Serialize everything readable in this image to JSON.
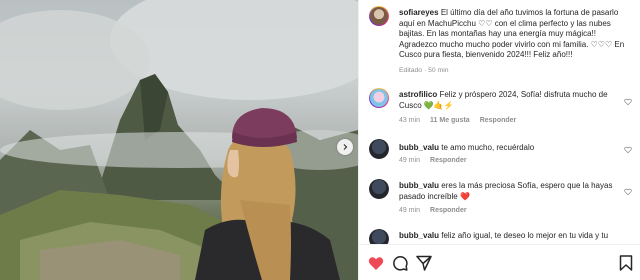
{
  "caption": {
    "username": "sofiareyes",
    "text": "El último día del año tuvimos la fortuna de pasarlo aquí en MachuPicchu ♡♡ con el clima perfecto y las nubes bajitas. En las montañas hay una energía muy mágica!! Agradezco mucho mucho poder vivirlo con mi familia. ♡♡♡ En Cusco pura fiesta, bienvenido 2024!!! Feliz año!!!",
    "edited": "Editado · 50 min"
  },
  "comments": [
    {
      "username": "astrofilico",
      "text": "Feliz y próspero 2024, Sofía! disfruta mucho de Cusco",
      "emoji": "💚🤙⚡",
      "time": "43 min",
      "likes": "11 Me gusta",
      "reply": "Responder"
    },
    {
      "username": "bubb_valu",
      "text": "te amo mucho, recuérdalo",
      "time": "49 min",
      "reply": "Responder"
    },
    {
      "username": "bubb_valu",
      "text": "eres la más preciosa Sofía, espero que la hayas pasado increíble",
      "emoji": "❤️",
      "time": "49 min",
      "reply": "Responder"
    },
    {
      "username": "bubb_valu",
      "text": "feliz año igual, te deseo lo mejor en tu vida y tu"
    }
  ],
  "icons": {
    "like": "heart-icon",
    "comment": "comment-bubble-icon",
    "share": "paper-plane-icon",
    "save": "bookmark-icon",
    "next": "chevron-right-icon"
  },
  "colors": {
    "text": "#262626",
    "muted": "#8e8e8e",
    "like_red": "#ed4956"
  }
}
